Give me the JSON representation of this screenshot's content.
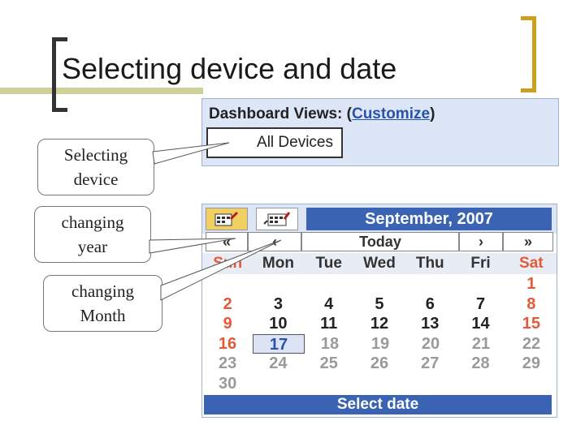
{
  "slide": {
    "title": "Selecting device and date"
  },
  "dashboard": {
    "title_prefix": "Dashboard Views: (",
    "customize_link": "Customize",
    "title_suffix": ")",
    "device_select_value": "All Devices"
  },
  "calendar": {
    "month_title": "September, 2007",
    "nav": {
      "prev_year": "«",
      "prev_month": "‹",
      "today": "Today",
      "next_month": "›",
      "next_year": "»"
    },
    "weekdays": [
      "Sun",
      "Mon",
      "Tue",
      "Wed",
      "Thu",
      "Fri",
      "Sat"
    ],
    "weeks": [
      [
        "",
        "",
        "",
        "",
        "",
        "",
        "1"
      ],
      [
        "2",
        "3",
        "4",
        "5",
        "6",
        "7",
        "8"
      ],
      [
        "9",
        "10",
        "11",
        "12",
        "13",
        "14",
        "15"
      ],
      [
        "16",
        "17",
        "18",
        "19",
        "20",
        "21",
        "22"
      ],
      [
        "23",
        "24",
        "25",
        "26",
        "27",
        "28",
        "29"
      ],
      [
        "30",
        "",
        "",
        "",
        "",
        "",
        ""
      ]
    ],
    "today_day": "17",
    "select_date_label": "Select date"
  },
  "callouts": {
    "device": [
      "Selecting",
      "device"
    ],
    "year": [
      "changing",
      "year"
    ],
    "month": [
      "changing",
      "Month"
    ]
  },
  "colors": {
    "accent_blue": "#3a63b3",
    "weekend_red": "#e35a3a",
    "panel_bg": "#dde6f7",
    "bracket_gold": "#c9a020"
  }
}
